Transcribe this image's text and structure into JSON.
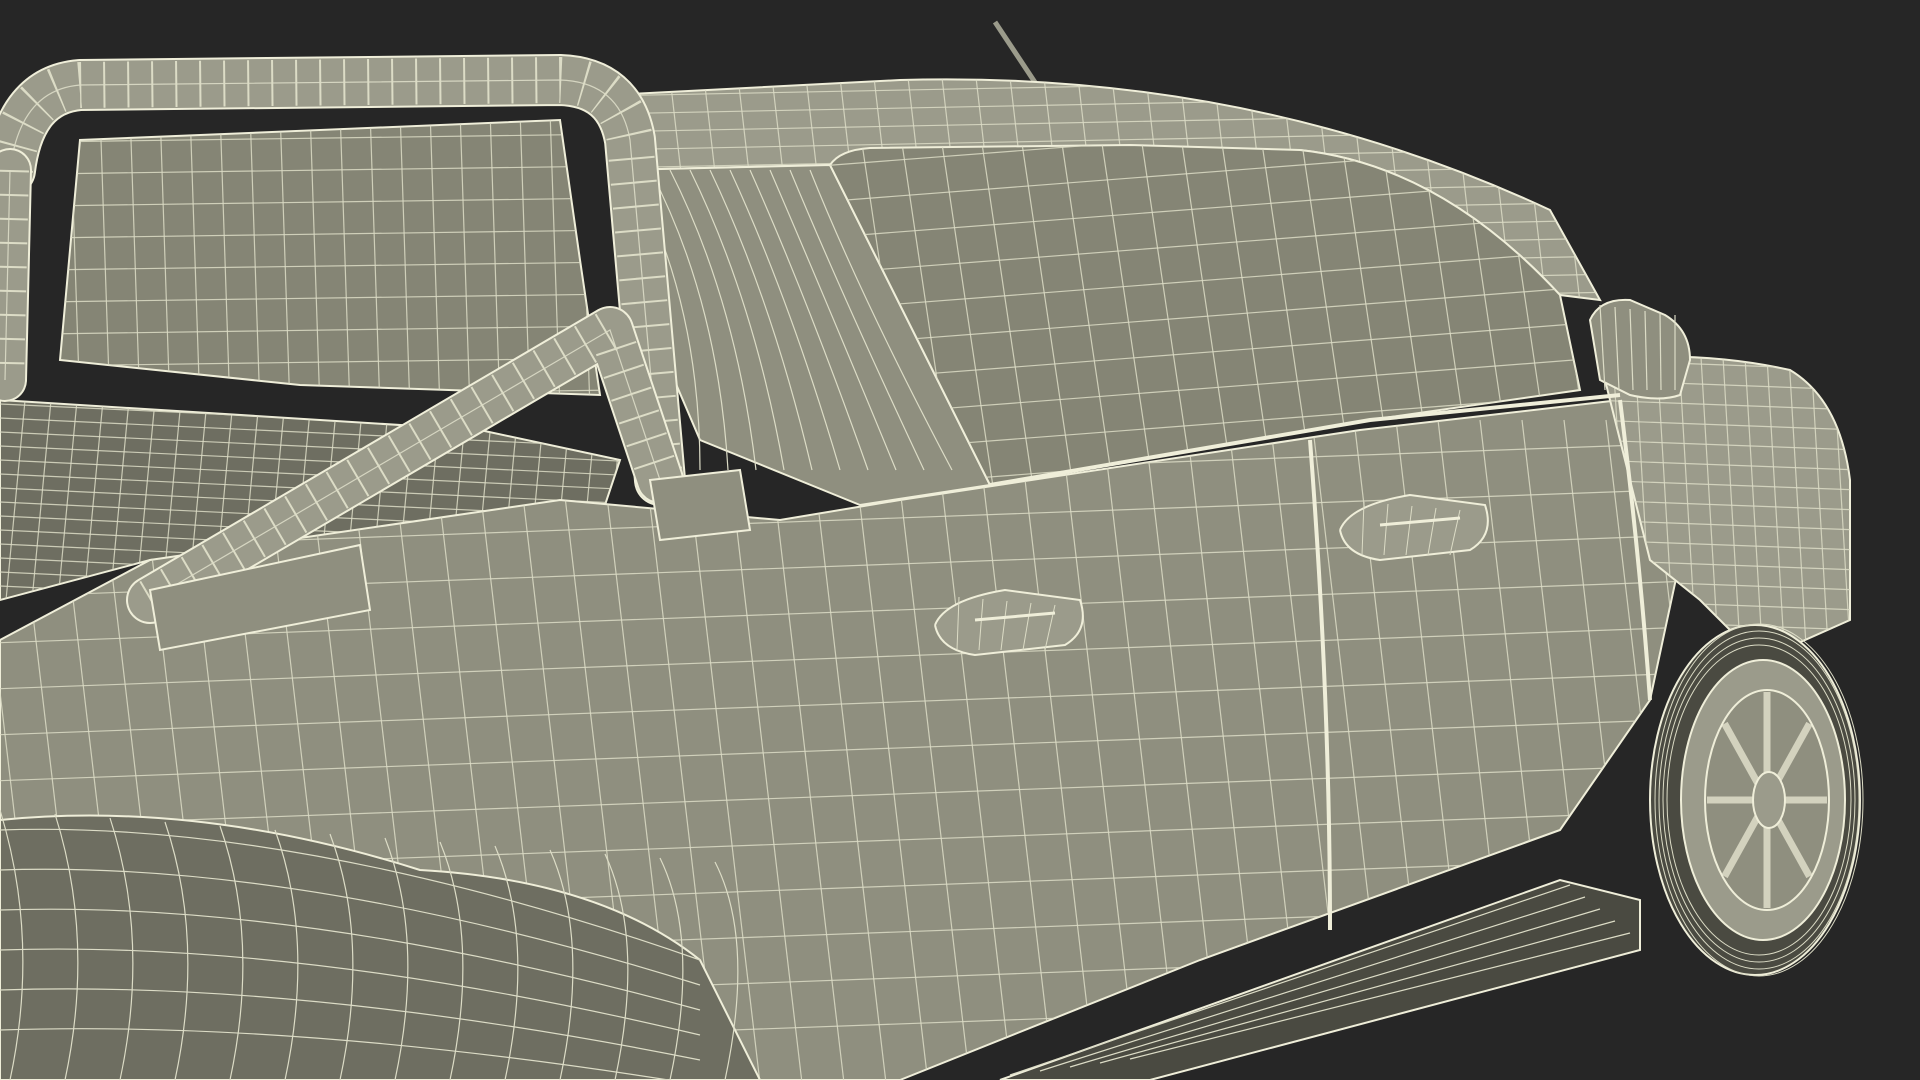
{
  "scene": {
    "subject": "pickup-truck-wireframe",
    "view": "rear-three-quarter-close-up",
    "parts": [
      "roll-bar",
      "cargo-bed",
      "rear-cab-window",
      "rear-door",
      "front-door",
      "door-handle-rear",
      "door-handle-front",
      "side-mirror",
      "antenna",
      "front-fender",
      "front-wheel",
      "side-step",
      "rear-fender"
    ]
  },
  "colors": {
    "background": "#262626",
    "surface": "#8f8f7f",
    "surface_light": "#9b9b8b",
    "surface_dark": "#6e6e61",
    "glass": "#858575",
    "wire": "#efeed9",
    "wire_soft": "#dcdcc6",
    "shadow": "#4a4a41"
  }
}
